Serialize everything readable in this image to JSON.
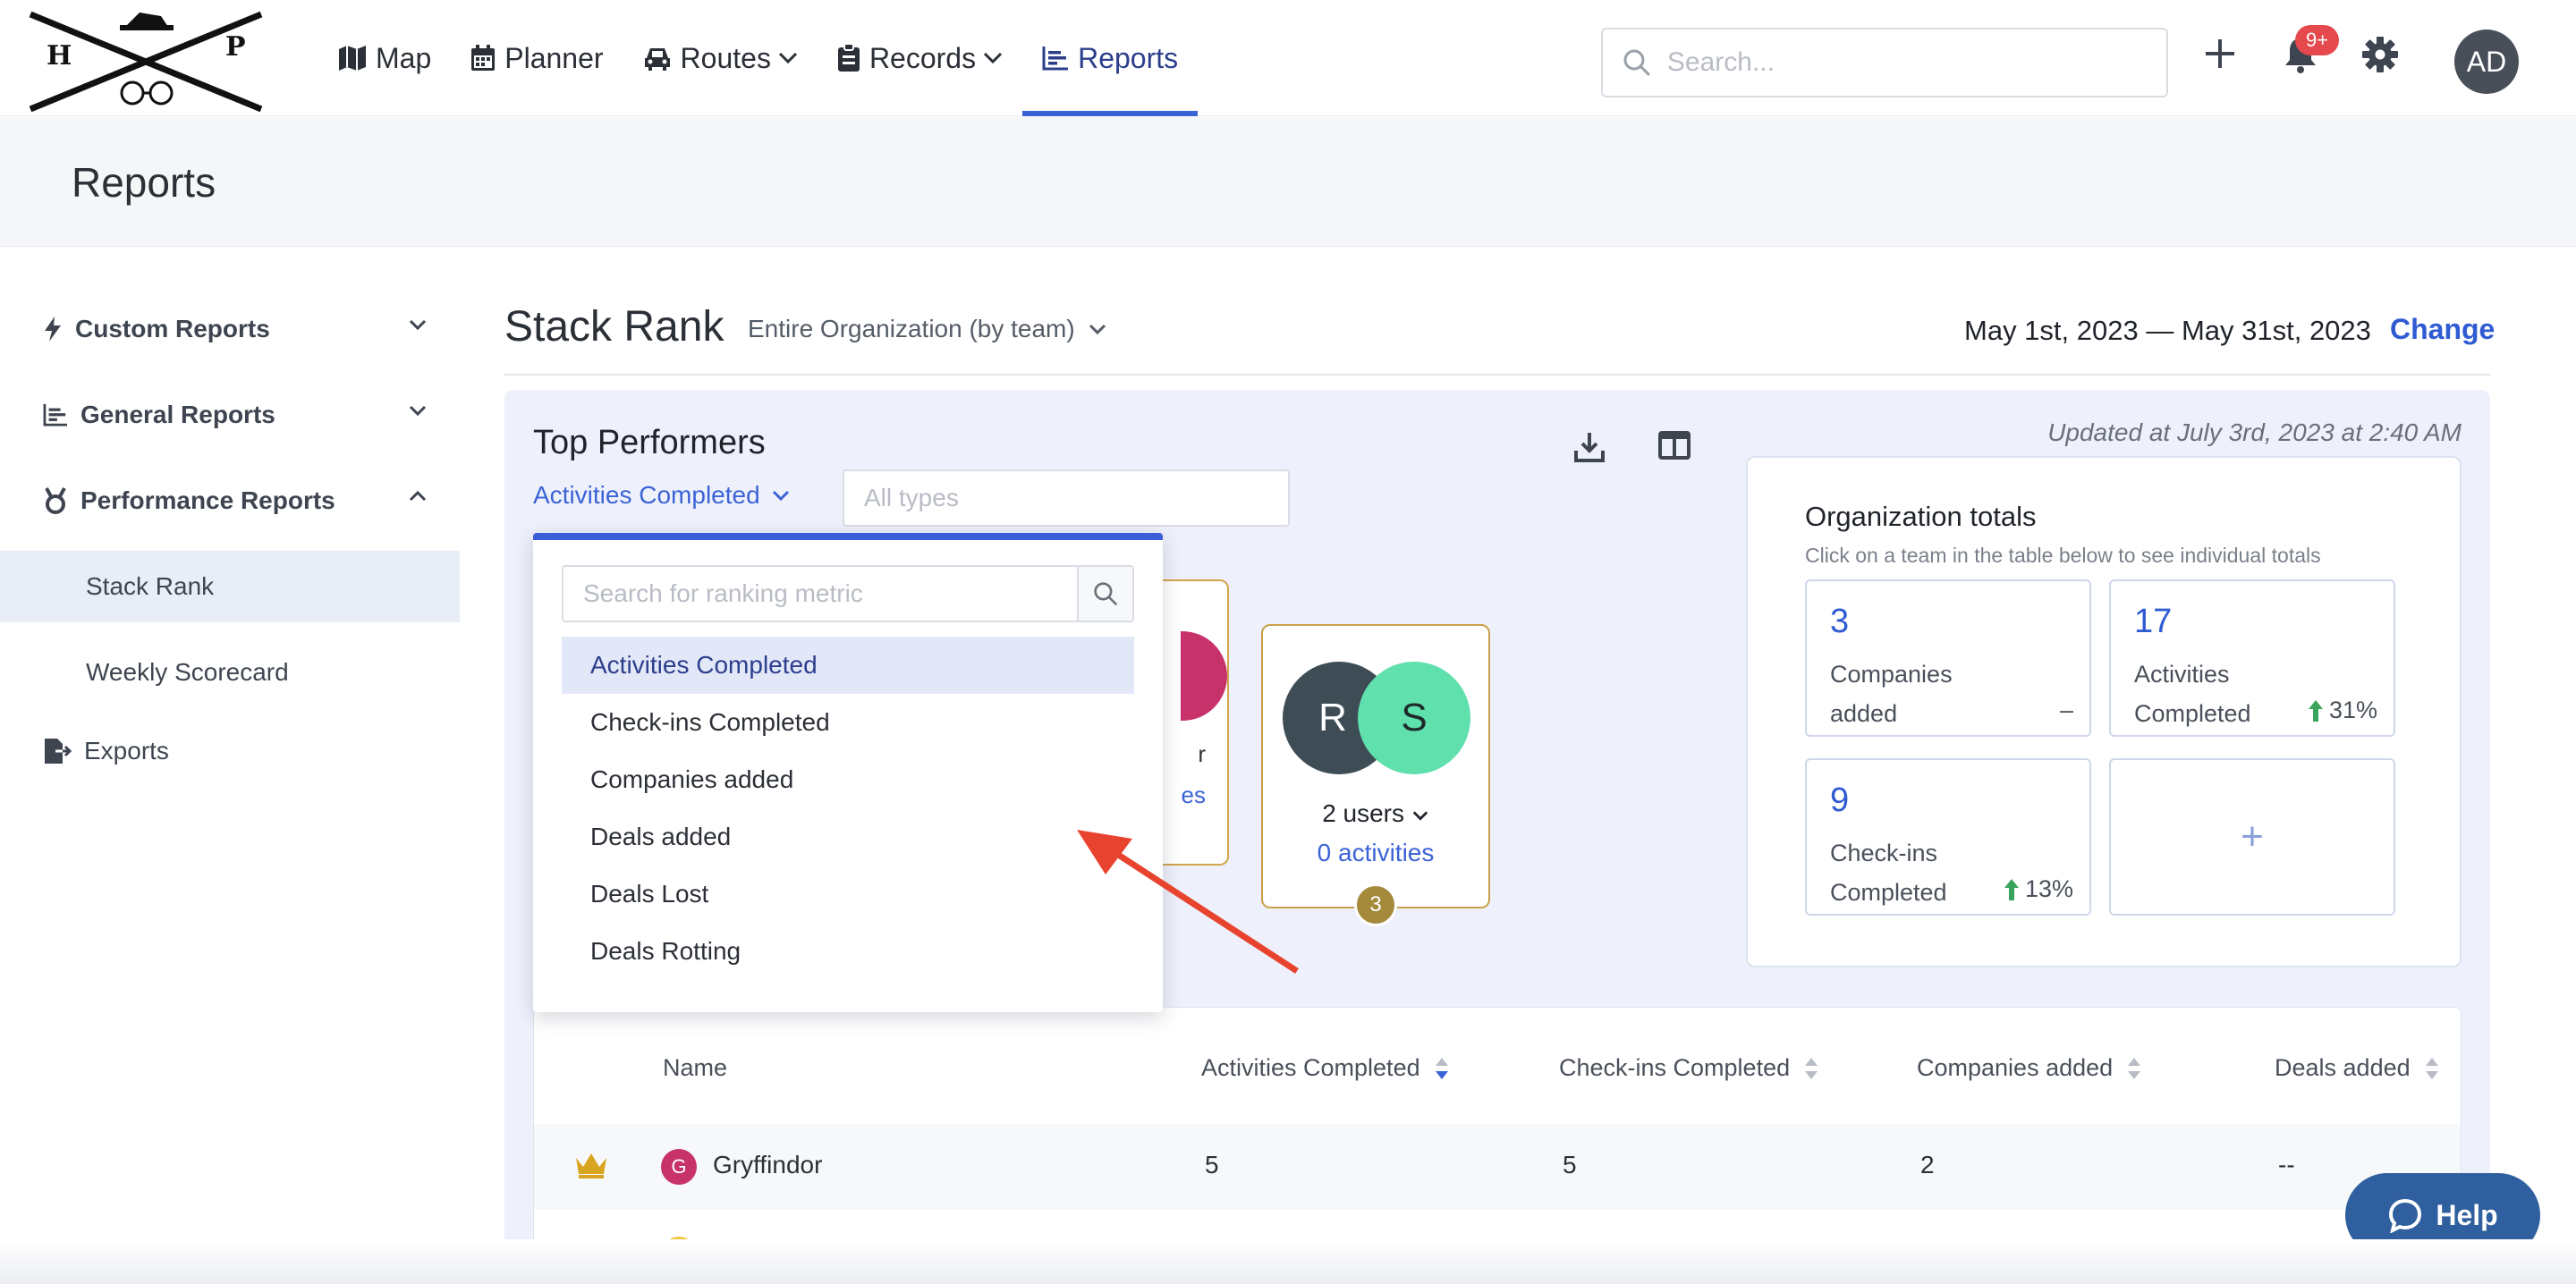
{
  "header": {
    "nav": [
      {
        "label": "Map",
        "icon": "map-icon"
      },
      {
        "label": "Planner",
        "icon": "calendar-icon"
      },
      {
        "label": "Routes",
        "icon": "car-icon"
      },
      {
        "label": "Records",
        "icon": "clipboard-icon"
      },
      {
        "label": "Reports",
        "icon": "chart-icon"
      }
    ],
    "search_placeholder": "Search...",
    "notification_badge": "9+",
    "avatar_initials": "AD",
    "accent_color": "#3b63d6"
  },
  "page_title": "Reports",
  "sidebar": {
    "sections": [
      {
        "label": "Custom Reports"
      },
      {
        "label": "General Reports"
      },
      {
        "label": "Performance Reports"
      }
    ],
    "sub_items": [
      {
        "label": "Stack Rank"
      },
      {
        "label": "Weekly Scorecard"
      }
    ],
    "exports": "Exports"
  },
  "main": {
    "title": "Stack Rank",
    "scope": "Entire Organization (by team)",
    "date_range": "May 1st, 2023 — May 31st, 2023",
    "change_label": "Change"
  },
  "card": {
    "title": "Top Performers",
    "metric": "Activities Completed",
    "types_placeholder": "All types",
    "updated": "Updated at July 3rd, 2023 at 2:40 AM"
  },
  "podium": {
    "partial_line1": "r",
    "partial_line2": "es",
    "third": {
      "avatar1": "R",
      "avatar2": "S",
      "users": "2 users",
      "activities": "0 activities",
      "rank": "3"
    }
  },
  "org_totals": {
    "title": "Organization totals",
    "subtitle": "Click on a team in the table below to see individual totals",
    "tiles": [
      {
        "value": "3",
        "label": "Companies added",
        "delta": "–"
      },
      {
        "value": "17",
        "label": "Activities Completed",
        "delta": "31%"
      },
      {
        "value": "9",
        "label": "Check-ins Completed",
        "delta": "13%"
      }
    ],
    "add_label": "+"
  },
  "table": {
    "headers": [
      "Name",
      "Activities Completed",
      "Check-ins Completed",
      "Companies added",
      "Deals added"
    ],
    "rows": [
      {
        "badge": "G",
        "name": "Gryffindor",
        "activities": "5",
        "checkins": "5",
        "companies": "2",
        "deals": "--"
      }
    ]
  },
  "dropdown": {
    "search_placeholder": "Search for ranking metric",
    "options": [
      "Activities Completed",
      "Check-ins Completed",
      "Companies added",
      "Deals added",
      "Deals Lost",
      "Deals Rotting"
    ],
    "selected": "Activities Completed"
  },
  "help_label": "Help"
}
